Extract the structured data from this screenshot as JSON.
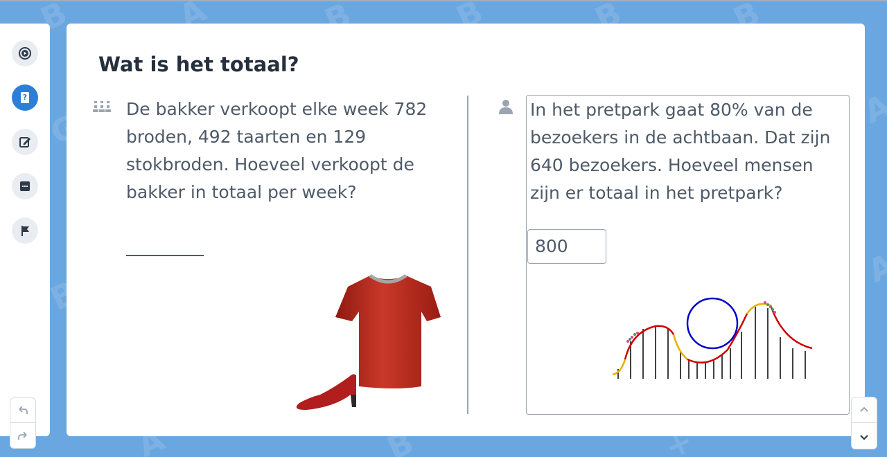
{
  "sidebar": {
    "buttons": [
      {
        "icon": "play-circle-icon"
      },
      {
        "icon": "question-book-icon",
        "active": true
      },
      {
        "icon": "edit-icon"
      },
      {
        "icon": "chat-icon"
      },
      {
        "icon": "flag-icon"
      }
    ],
    "undo_icon": "undo-icon",
    "redo_icon": "redo-icon"
  },
  "exercise": {
    "title": "Wat is het totaal?",
    "left_question": {
      "icon": "group-icon",
      "text": "De bakker verkoopt elke week 782 broden, 492 taarten en 129 stokbroden. Hoeveel verkoopt de bakker in totaal per week?",
      "answer": ""
    },
    "right_question": {
      "icon": "person-icon",
      "text": "In het pretpark gaat 80% van de bezoekers in de achtbaan. Dat zijn 640 bezoekers. Hoeveel mensen zijn er totaal in het pretpark?",
      "answer": "800"
    }
  },
  "scroll": {
    "up_icon": "chevron-up-icon",
    "down_icon": "chevron-down-icon"
  },
  "colors": {
    "background": "#6aa6e0",
    "accent": "#2c7fd6",
    "text": "#4e5a68",
    "title": "#26303d"
  }
}
